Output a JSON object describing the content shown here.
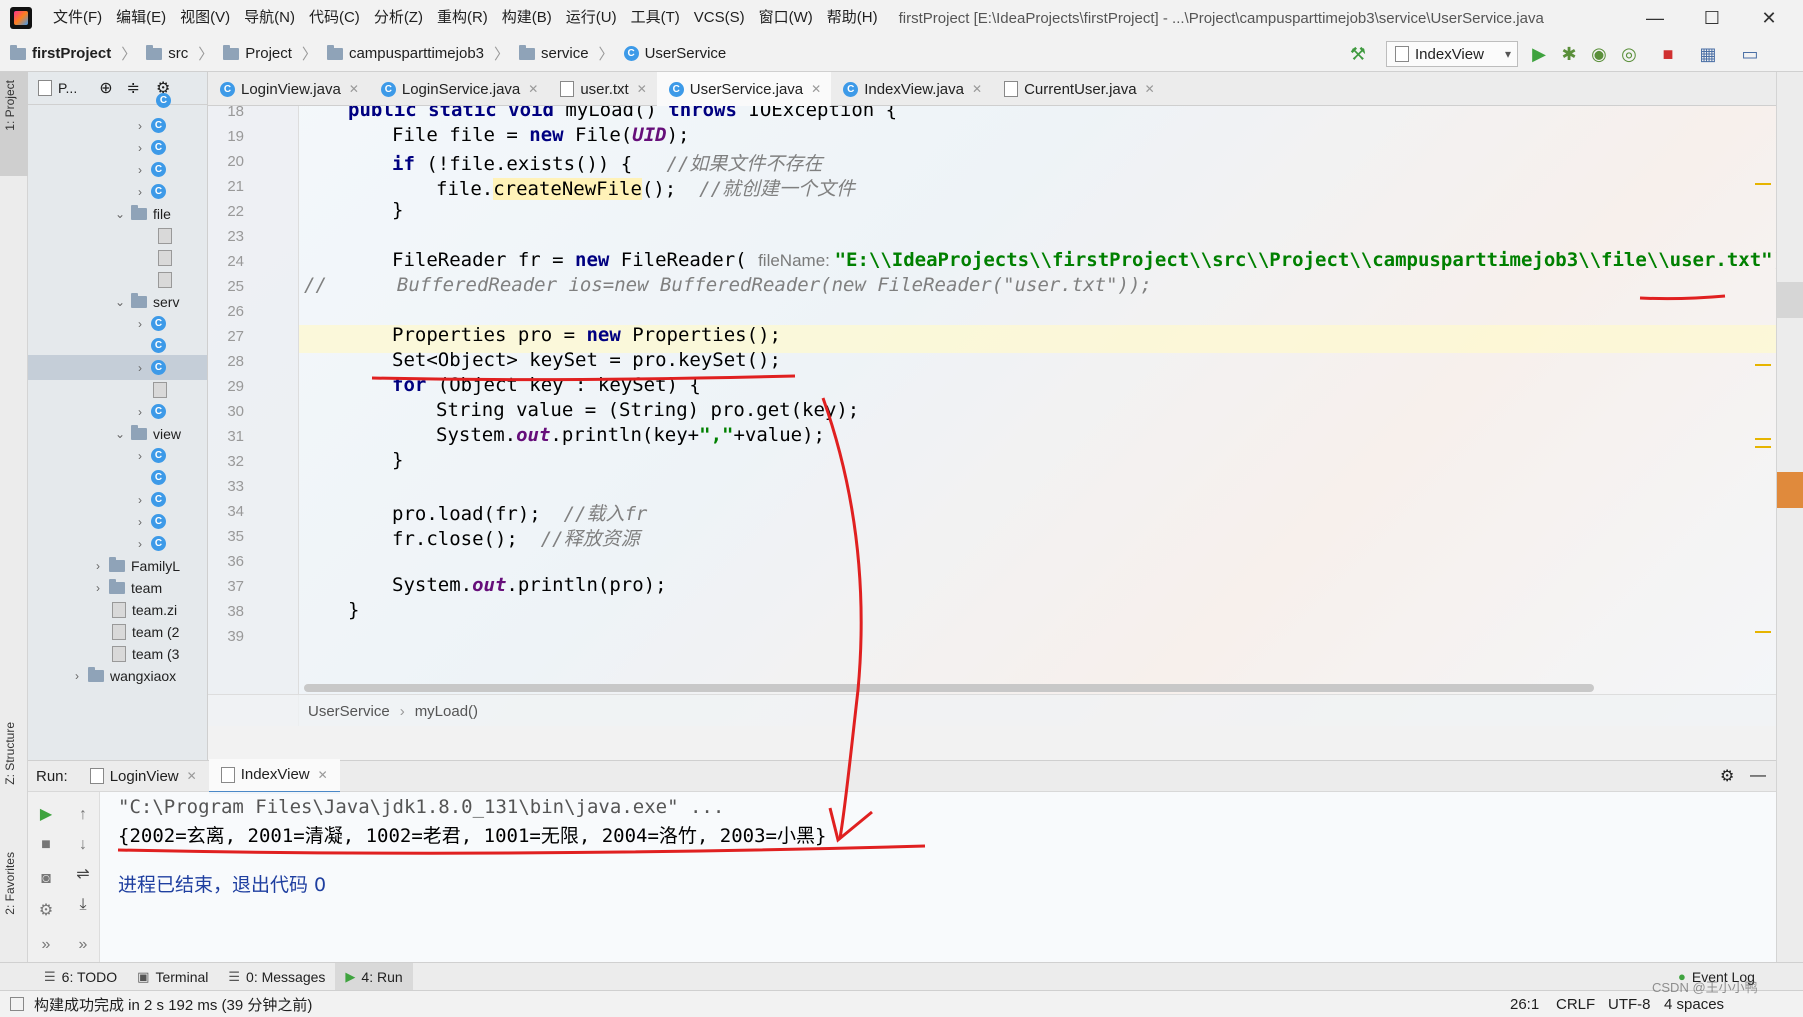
{
  "menu": [
    "文件(F)",
    "编辑(E)",
    "视图(V)",
    "导航(N)",
    "代码(C)",
    "分析(Z)",
    "重构(R)",
    "构建(B)",
    "运行(U)",
    "工具(T)",
    "VCS(S)",
    "窗口(W)",
    "帮助(H)"
  ],
  "window_title": "firstProject [E:\\IdeaProjects\\firstProject] - ...\\Project\\campusparttimejob3\\service\\UserService.java",
  "breadcrumb": [
    "firstProject",
    "src",
    "Project",
    "campusparttimejob3",
    "service",
    "UserService"
  ],
  "run_config": "IndexView",
  "left_strip": {
    "project": "1: Project",
    "structure": "Z: Structure",
    "favorites": "2: Favorites"
  },
  "project_toolbar": "P...",
  "tree": [
    {
      "label": "file"
    },
    {
      "label": "serv"
    },
    {
      "label": "view"
    },
    {
      "label": "FamilyL"
    },
    {
      "label": "team"
    },
    {
      "label": "team.zi"
    },
    {
      "label": "team (2"
    },
    {
      "label": "team (3"
    },
    {
      "label": "wangxiaox"
    }
  ],
  "tabs": [
    "LoginView.java",
    "LoginService.java",
    "user.txt",
    "UserService.java",
    "IndexView.java",
    "CurrentUser.java"
  ],
  "line_numbers": [
    "18",
    "19",
    "20",
    "21",
    "22",
    "23",
    "24",
    "25",
    "26",
    "27",
    "28",
    "29",
    "30",
    "31",
    "32",
    "33",
    "34",
    "35",
    "36",
    "37",
    "38",
    "39"
  ],
  "code": {
    "l18a": "public static void ",
    "l18b": "myLoad() ",
    "l18c": "throws ",
    "l18d": "IOException {",
    "l19a": "File file = ",
    "l19b": "new ",
    "l19c": "File(",
    "l19d": "UID",
    "l19e": ");",
    "l20a": "if ",
    "l20b": "(!file.exists()) {   ",
    "l20c": "//如果文件不存在",
    "l21a": "file.",
    "l21b": "createNewFile",
    "l21c": "();  ",
    "l21d": "//就创建一个文件",
    "l22": "}",
    "l24a": "FileReader fr = ",
    "l24b": "new ",
    "l24c": "FileReader( ",
    "l24hint": "fileName: ",
    "l24str": "\"E:\\\\IdeaProjects\\\\firstProject\\\\src\\\\Project\\\\campusparttimejob3\\\\file\\\\user.txt\"",
    "l24e": ");",
    "l25a": "//",
    "l25b": "BufferedReader ios=new BufferedReader(new FileReader(\"user.txt\"));",
    "l27a": "Properties pro = ",
    "l27b": "new ",
    "l27c": "Properties();",
    "l28": "Set<Object> keySet = pro.keySet();",
    "l29a": "for ",
    "l29b": "(Object key : keySet) {",
    "l30": "String value = (String) pro.get(key);",
    "l31a": "System.",
    "l31b": "out",
    "l31c": ".println(key+",
    "l31d": "\",\"",
    "l31e": "+value);",
    "l32": "}",
    "l34a": "pro.load(fr);  ",
    "l34b": "//载入fr",
    "l35a": "fr.close();  ",
    "l35b": "//释放资源",
    "l37a": "System.",
    "l37b": "out",
    "l37c": ".println(pro);",
    "l38": "}"
  },
  "editor_breadcrumb": [
    "UserService",
    "myLoad()"
  ],
  "run": {
    "label": "Run:",
    "tabs": [
      "LoginView",
      "IndexView"
    ],
    "console": [
      "\"C:\\Program Files\\Java\\jdk1.8.0_131\\bin\\java.exe\" ...",
      "{2002=玄离, 2001=清凝, 1002=老君, 1001=无限, 2004=洛竹, 2003=小黑}",
      "进程已结束，退出代码 0"
    ]
  },
  "tool_tabs": [
    "6: TODO",
    "Terminal",
    "0: Messages",
    "4: Run"
  ],
  "event_log": "Event Log",
  "status": {
    "message": "构建成功完成 in 2 s 192 ms (39 分钟之前)",
    "position": "26:1",
    "line_sep": "CRLF",
    "encoding": "UTF-8",
    "indent": "4 spaces",
    "watermark": "CSDN @王小小鸭"
  },
  "colors": {
    "keyword": "#000080",
    "string": "#008000",
    "comment": "#808080",
    "annotation": "#e02020",
    "accent": "#4a88c7"
  }
}
